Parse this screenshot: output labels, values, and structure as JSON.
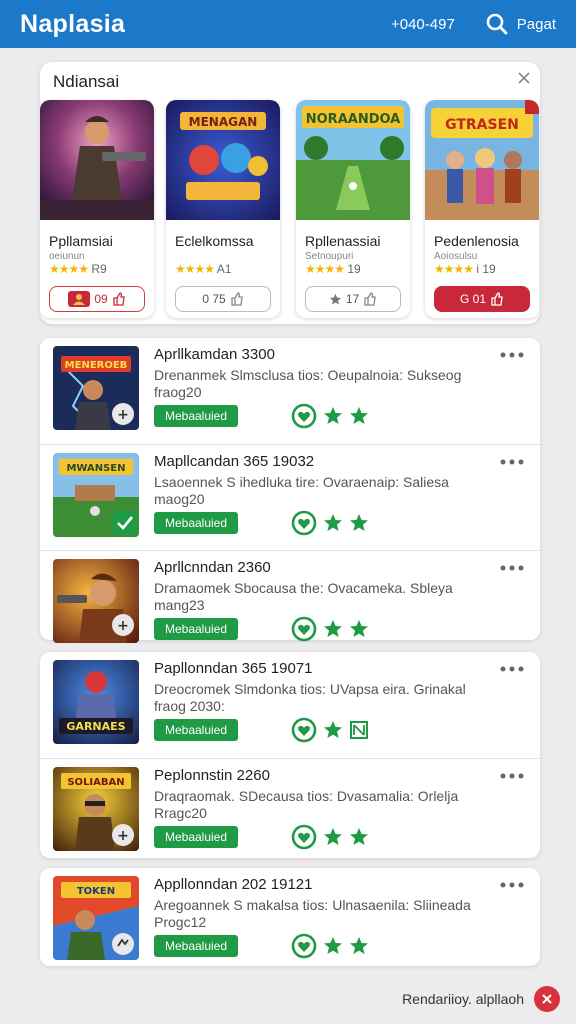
{
  "app": {
    "title": "Naplasia",
    "phone": "+040-497",
    "search_label": "Pagat"
  },
  "featured": {
    "title": "Ndiansai",
    "cards": [
      {
        "name": "Ppllamsiai",
        "sub": "oeiunun",
        "stars": "★★★★",
        "rating": "R9",
        "button": "09"
      },
      {
        "name": "Eclelkomssa",
        "sub": "",
        "stars": "★★★★",
        "rating": "A1",
        "button": "0 75"
      },
      {
        "name": "Rpllenassiai",
        "sub": "Setnoupuri",
        "stars": "★★★★",
        "rating": "19",
        "button": "17"
      },
      {
        "name": "Pedenlenosia",
        "sub": "Aoiosulsu",
        "stars": "★★★★",
        "rating": "i 19",
        "button": "G 01"
      }
    ]
  },
  "apps": [
    {
      "title": "Aprllkamdan 3300",
      "desc": "Drenanmek Slmsclusa tios: Oeupalnoia: Sukseog fraog20",
      "tag": "Mebaaluied"
    },
    {
      "title": "Mapllcandan 365 19032",
      "desc": "Lsaoennek S ihedluka tire: Ovaraenaip: Saliesa maog20",
      "tag": "Mebaaluied"
    },
    {
      "title": "Aprllcnndan 2360",
      "desc": "Dramaomek Sbocausa the: Ovacameka. Sbleya mang23",
      "tag": "Mebaaluied"
    },
    {
      "title": "Papllonndan 365 19071",
      "desc": "Dreocromek Slmdonka tios: UVapsa eira. Grinakal fraog 2030:",
      "tag": "Mebaaluied"
    },
    {
      "title": "Peplonnstin 2260",
      "desc": "Draqraomak. SDecausa tios: Dvasamalia: Orlelja Rragc20",
      "tag": "Mebaaluied"
    },
    {
      "title": "Appllonndan 202 19121",
      "desc": "Aregoannek S makalsa tios: Ulnasaenila: Sliineada Progc12",
      "tag": "Mebaaluied"
    }
  ],
  "footer": {
    "label": "Rendariioy. alpllaoh"
  },
  "colors": {
    "primary": "#1c78c9",
    "green": "#1f9b45",
    "red": "#c9283a",
    "star": "#f0b400"
  },
  "icons": {
    "search": "search-icon",
    "close": "close-icon",
    "more": "more-horizontal-icon",
    "heart": "heart-circle-icon",
    "star": "star-icon",
    "add": "plus-icon",
    "check": "check-icon",
    "like": "thumbs-up-icon"
  }
}
